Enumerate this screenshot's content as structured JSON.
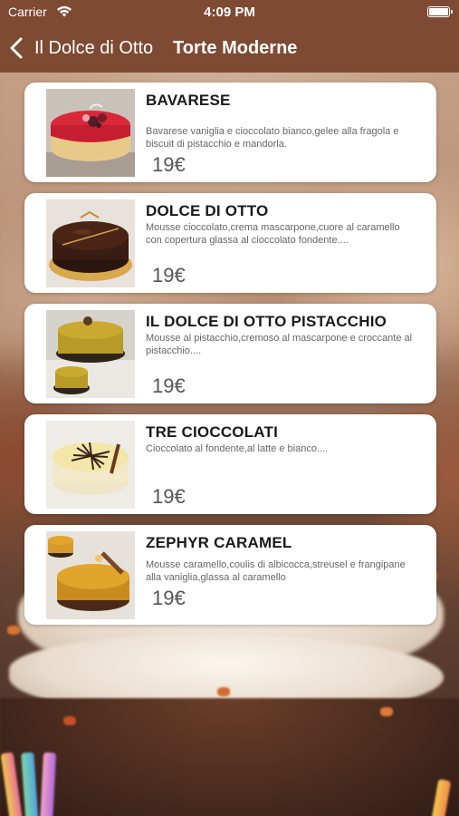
{
  "status_bar": {
    "carrier": "Carrier",
    "time": "4:09 PM"
  },
  "nav": {
    "back_label": "Il Dolce di Otto",
    "title": "Torte Moderne",
    "bar_color": "#7f4a33"
  },
  "products": [
    {
      "name": "BAVARESE",
      "description": "Bavarese vaniglia e cioccolato bianco,gelee alla fragola e biscuit di pistacchio e mandorla.",
      "price": "19€"
    },
    {
      "name": "DOLCE DI OTTO",
      "description": "Mousse cioccolato,crema mascarpone,cuore al caramello con copertura glassa al cioccolato fondente....",
      "price": "19€"
    },
    {
      "name": "IL DOLCE DI OTTO PISTACCHIO",
      "description": "Mousse al pistacchio,cremoso al mascarpone e croccante al pistacchio....",
      "price": "19€"
    },
    {
      "name": "TRE CIOCCOLATI",
      "description": "Cioccolato al fondente,al latte e bianco....",
      "price": "19€"
    },
    {
      "name": "ZEPHYR CARAMEL",
      "description": "Mousse caramello,coulis di albicocca,streusel e frangipane alla vaniglia,glassa al caramello",
      "price": "19€"
    }
  ]
}
